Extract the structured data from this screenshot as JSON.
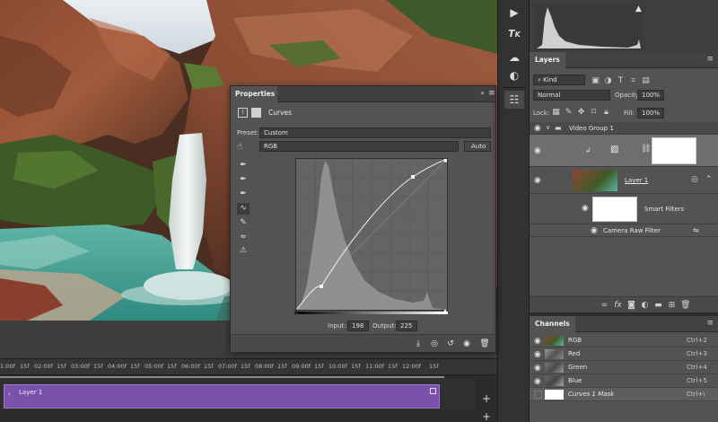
{
  "canvas": {
    "description_name": "waterfall-photo"
  },
  "timeline": {
    "ticks": [
      "1:00f",
      "15f",
      "02:00f",
      "15f",
      "03:00f",
      "15f",
      "04:00f",
      "15f",
      "05:00f",
      "15f",
      "06:00f",
      "15f",
      "07:00f",
      "15f",
      "08:00f",
      "15f",
      "09:00f",
      "15f",
      "10:00f",
      "15f",
      "11:00f",
      "15f",
      "12:00f",
      "15f"
    ],
    "clip_label": "Layer 1",
    "add_label": "+"
  },
  "histogram_panel": {
    "warning_icon": "warning-icon"
  },
  "layers": {
    "tab": "Layers",
    "filter": "Kind",
    "blend_mode": "Normal",
    "opacity_label": "Opacity:",
    "opacity_value": "100%",
    "lock_label": "Lock:",
    "fill_label": "Fill:",
    "fill_value": "100%",
    "group_name": "Video Group 1",
    "layer_name": "Layer 1",
    "smart_filters": "Smart Filters",
    "camera_raw": "Camera Raw Filter"
  },
  "channels": {
    "tab": "Channels",
    "rows": [
      {
        "name": "RGB",
        "key": "Ctrl+2"
      },
      {
        "name": "Red",
        "key": "Ctrl+3"
      },
      {
        "name": "Green",
        "key": "Ctrl+4"
      },
      {
        "name": "Blue",
        "key": "Ctrl+5"
      },
      {
        "name": "Curves 1 Mask",
        "key": "Ctrl+\\"
      }
    ]
  },
  "properties": {
    "tab": "Properties",
    "title": "Curves",
    "preset_label": "Preset:",
    "preset_value": "Custom",
    "channel_value": "RGB",
    "auto_label": "Auto",
    "input_label": "Input:",
    "input_value": "198",
    "output_label": "Output:",
    "output_value": "225"
  },
  "colors": {
    "clip": "#7b52ab",
    "panel": "#535353",
    "dark": "#282828"
  }
}
